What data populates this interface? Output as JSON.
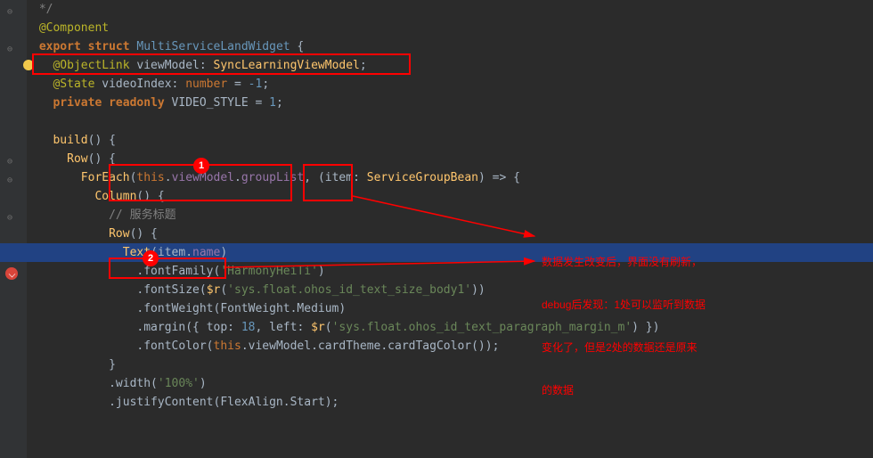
{
  "code": {
    "l1a": " */",
    "l2_ann": "@Component",
    "l3_kw1": "export",
    "l3_kw2": "struct",
    "l3_name": "MultiServiceLandWidget",
    "l3_brace": " {",
    "l4_ann": "@ObjectLink",
    "l4_ident": " viewModel",
    "l4_colon": ": ",
    "l4_type": "SyncLearningViewModel",
    "l4_semi": ";",
    "l5_ann": "@State",
    "l5_ident": " videoIndex",
    "l5_colon": ": ",
    "l5_type": "number",
    "l5_eq": " = ",
    "l5_val": "-1",
    "l5_semi": ";",
    "l6_kw1": "private",
    "l6_kw2": "readonly",
    "l6_ident": " VIDEO_STYLE",
    "l6_eq": " = ",
    "l6_val": "1",
    "l6_semi": ";",
    "l8_fn": "build",
    "l8_paren": "()",
    "l8_brace": " {",
    "l9_fn": "Row",
    "l9_paren": "()",
    "l9_brace": " {",
    "l10_fn": "ForEach",
    "l10_open": "(",
    "l10_this": "this",
    "l10_dot1": ".",
    "l10_vm": "viewModel",
    "l10_dot2": ".",
    "l10_gl": "groupList",
    "l10_comma": ", (",
    "l10_item": "item",
    "l10_colon": ": ",
    "l10_type": "ServiceGroupBean",
    "l10_arrow": ") => {",
    "l11_fn": "Column",
    "l11_paren": "()",
    "l11_brace": " {",
    "l12_comment": "// 服务标题",
    "l13_fn": "Row",
    "l13_paren": "()",
    "l13_brace": " {",
    "l14_fn": "Text",
    "l14_open": "(",
    "l14_item": "item",
    "l14_dot": ".",
    "l14_name": "name",
    "l14_close": ")",
    "l15_call": ".fontFamily(",
    "l15_str": "'HarmonyHeiTi'",
    "l15_close": ")",
    "l16_call": ".fontSize(",
    "l16_r": "$r",
    "l16_open": "(",
    "l16_str": "'sys.float.ohos_id_text_size_body1'",
    "l16_close": "))",
    "l17_call": ".fontWeight(FontWeight.Medium)",
    "l18_call": ".margin({ ",
    "l18_top": "top",
    "l18_c1": ": ",
    "l18_tv": "18",
    "l18_c2": ", ",
    "l18_left": "left",
    "l18_c3": ": ",
    "l18_r": "$r",
    "l18_open": "(",
    "l18_str": "'sys.float.ohos_id_text_paragraph_margin_m'",
    "l18_close": ") })",
    "l19_call": ".fontColor(",
    "l19_this": "this",
    "l19_rest": ".viewModel.cardTheme.cardTagColor());",
    "l20_brace": "}",
    "l21_call": ".width(",
    "l21_str": "'100%'",
    "l21_close": ")",
    "l22_call": ".justifyContent(FlexAlign.Start);"
  },
  "badges": {
    "b1": "1",
    "b2": "2"
  },
  "note": {
    "l1": "数据发生改变后，界面没有刷新，",
    "l2": "debug后发现：1处可以监听到数据",
    "l3": "变化了，但是2处的数据还是原来",
    "l4": "的数据"
  }
}
